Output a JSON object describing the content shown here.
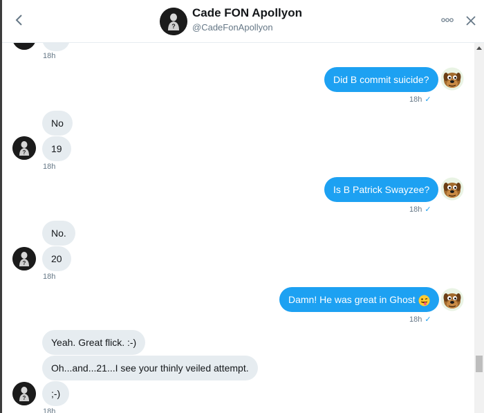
{
  "header": {
    "name": "Cade FON Apollyon",
    "handle": "@CadeFonApollyon"
  },
  "messages": [
    {
      "text": "",
      "time": "18h"
    },
    {
      "text": "Did B commit suicide?",
      "time": "18h"
    },
    {
      "text": "No",
      "time": ""
    },
    {
      "text": "19",
      "time": "18h"
    },
    {
      "text": "Is B Patrick Swayzee?",
      "time": "18h"
    },
    {
      "text": "No.",
      "time": ""
    },
    {
      "text": "20",
      "time": "18h"
    },
    {
      "text": "Damn! He was great in Ghost",
      "time": "18h"
    },
    {
      "text": "Yeah. Great flick. :-)",
      "time": ""
    },
    {
      "text": "Oh...and...21...I see your thinly veiled attempt.",
      "time": ""
    },
    {
      "text": ";-)",
      "time": "18h"
    }
  ],
  "check_glyph": "✓",
  "colors": {
    "outgoing": "#1da1f2",
    "incoming": "#e6ecf0"
  }
}
